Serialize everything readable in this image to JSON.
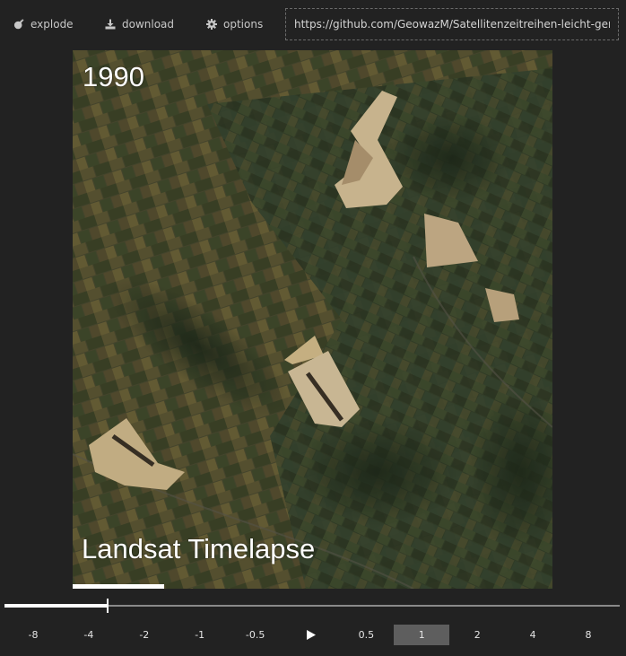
{
  "toolbar": {
    "explode_label": "explode",
    "download_label": "download",
    "options_label": "options",
    "url_value": "https://github.com/GeowazM/Satellitenzeitreihen-leicht-gemacht"
  },
  "icons": {
    "explode": "bomb-icon",
    "download": "download-icon",
    "options": "gear-icon",
    "play": "play-icon"
  },
  "viewer": {
    "year": "1990",
    "caption": "Landsat Timelapse",
    "frame_progress": 0.19
  },
  "timeline": {
    "position": 0.167
  },
  "speeds": {
    "options": [
      "-8",
      "-4",
      "-2",
      "-1",
      "-0.5",
      "0.5",
      "1",
      "2",
      "4",
      "8"
    ],
    "selected": "1"
  },
  "colors": {
    "background": "#222222",
    "active_speed": "#5e5e5e",
    "progress": "#ffffff",
    "track": "#8a8a8a"
  }
}
